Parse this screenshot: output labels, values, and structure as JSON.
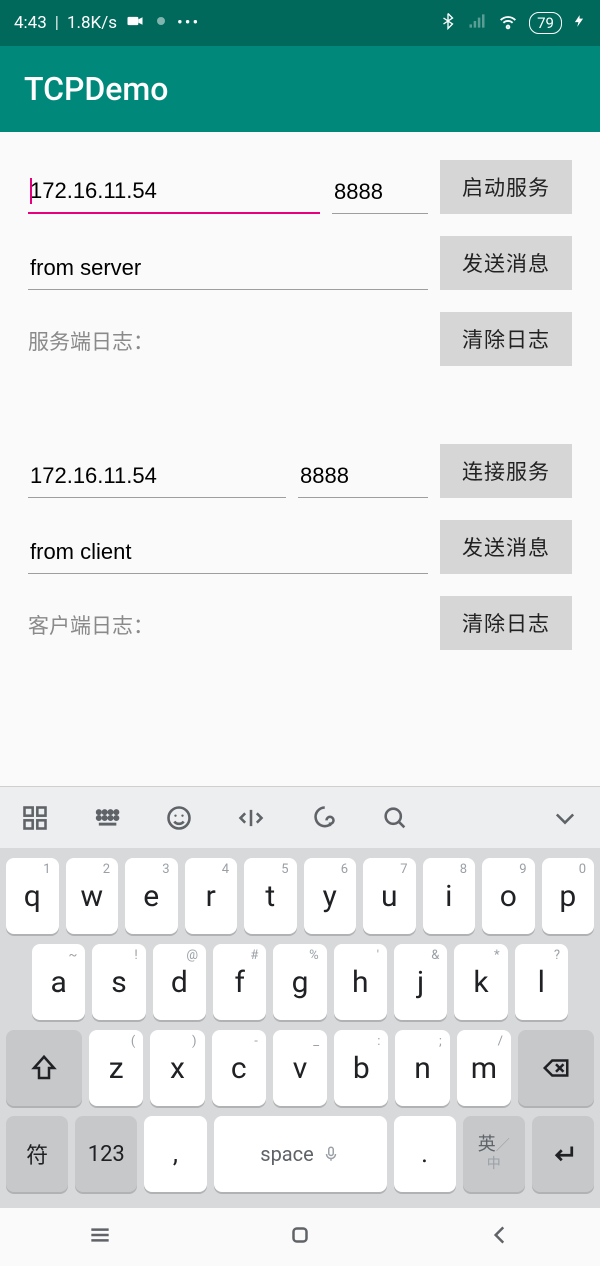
{
  "status": {
    "time": "4:43",
    "net_speed": "1.8K/s",
    "battery": "79"
  },
  "app": {
    "title": "TCPDemo"
  },
  "server": {
    "ip": "172.16.11.54",
    "port": "8888",
    "start_btn": "启动服务",
    "msg": "from server",
    "send_btn": "发送消息",
    "log_label": "服务端日志：",
    "clear_btn": "清除日志"
  },
  "client": {
    "ip": "172.16.11.54",
    "port": "8888",
    "connect_btn": "连接服务",
    "msg": "from client",
    "send_btn": "发送消息",
    "log_label": "客户端日志：",
    "clear_btn": "清除日志"
  },
  "keyboard": {
    "row1": [
      {
        "k": "q",
        "a": "1"
      },
      {
        "k": "w",
        "a": "2"
      },
      {
        "k": "e",
        "a": "3"
      },
      {
        "k": "r",
        "a": "4"
      },
      {
        "k": "t",
        "a": "5"
      },
      {
        "k": "y",
        "a": "6"
      },
      {
        "k": "u",
        "a": "7"
      },
      {
        "k": "i",
        "a": "8"
      },
      {
        "k": "o",
        "a": "9"
      },
      {
        "k": "p",
        "a": "0"
      }
    ],
    "row2": [
      {
        "k": "a",
        "a": "~"
      },
      {
        "k": "s",
        "a": "!"
      },
      {
        "k": "d",
        "a": "@"
      },
      {
        "k": "f",
        "a": "#"
      },
      {
        "k": "g",
        "a": "%"
      },
      {
        "k": "h",
        "a": "'"
      },
      {
        "k": "j",
        "a": "&"
      },
      {
        "k": "k",
        "a": "*"
      },
      {
        "k": "l",
        "a": "?"
      }
    ],
    "row3": [
      {
        "k": "z",
        "a": "("
      },
      {
        "k": "x",
        "a": ")"
      },
      {
        "k": "c",
        "a": "-"
      },
      {
        "k": "v",
        "a": "_"
      },
      {
        "k": "b",
        "a": ":"
      },
      {
        "k": "n",
        "a": ";"
      },
      {
        "k": "m",
        "a": "/"
      }
    ],
    "sym": "符",
    "num": "123",
    "comma": ",",
    "space": "space",
    "dot": ".",
    "lang_top": "英",
    "lang_bot": "中"
  }
}
